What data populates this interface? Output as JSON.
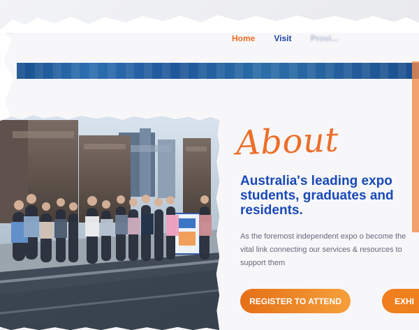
{
  "nav": {
    "home": "Home",
    "visit": "Visit",
    "third": "Provi..."
  },
  "hero": {
    "title": "About",
    "heading": "Australia's leading expo students, graduates and residents.",
    "body": "As the foremost independent expo o become the vital link connecting our services & resources to support them",
    "buttons": {
      "register": "REGISTER TO ATTEND",
      "exhibit": "EXHI"
    }
  },
  "colors": {
    "accent_orange": "#F26D1F",
    "accent_blue": "#1849B7"
  }
}
